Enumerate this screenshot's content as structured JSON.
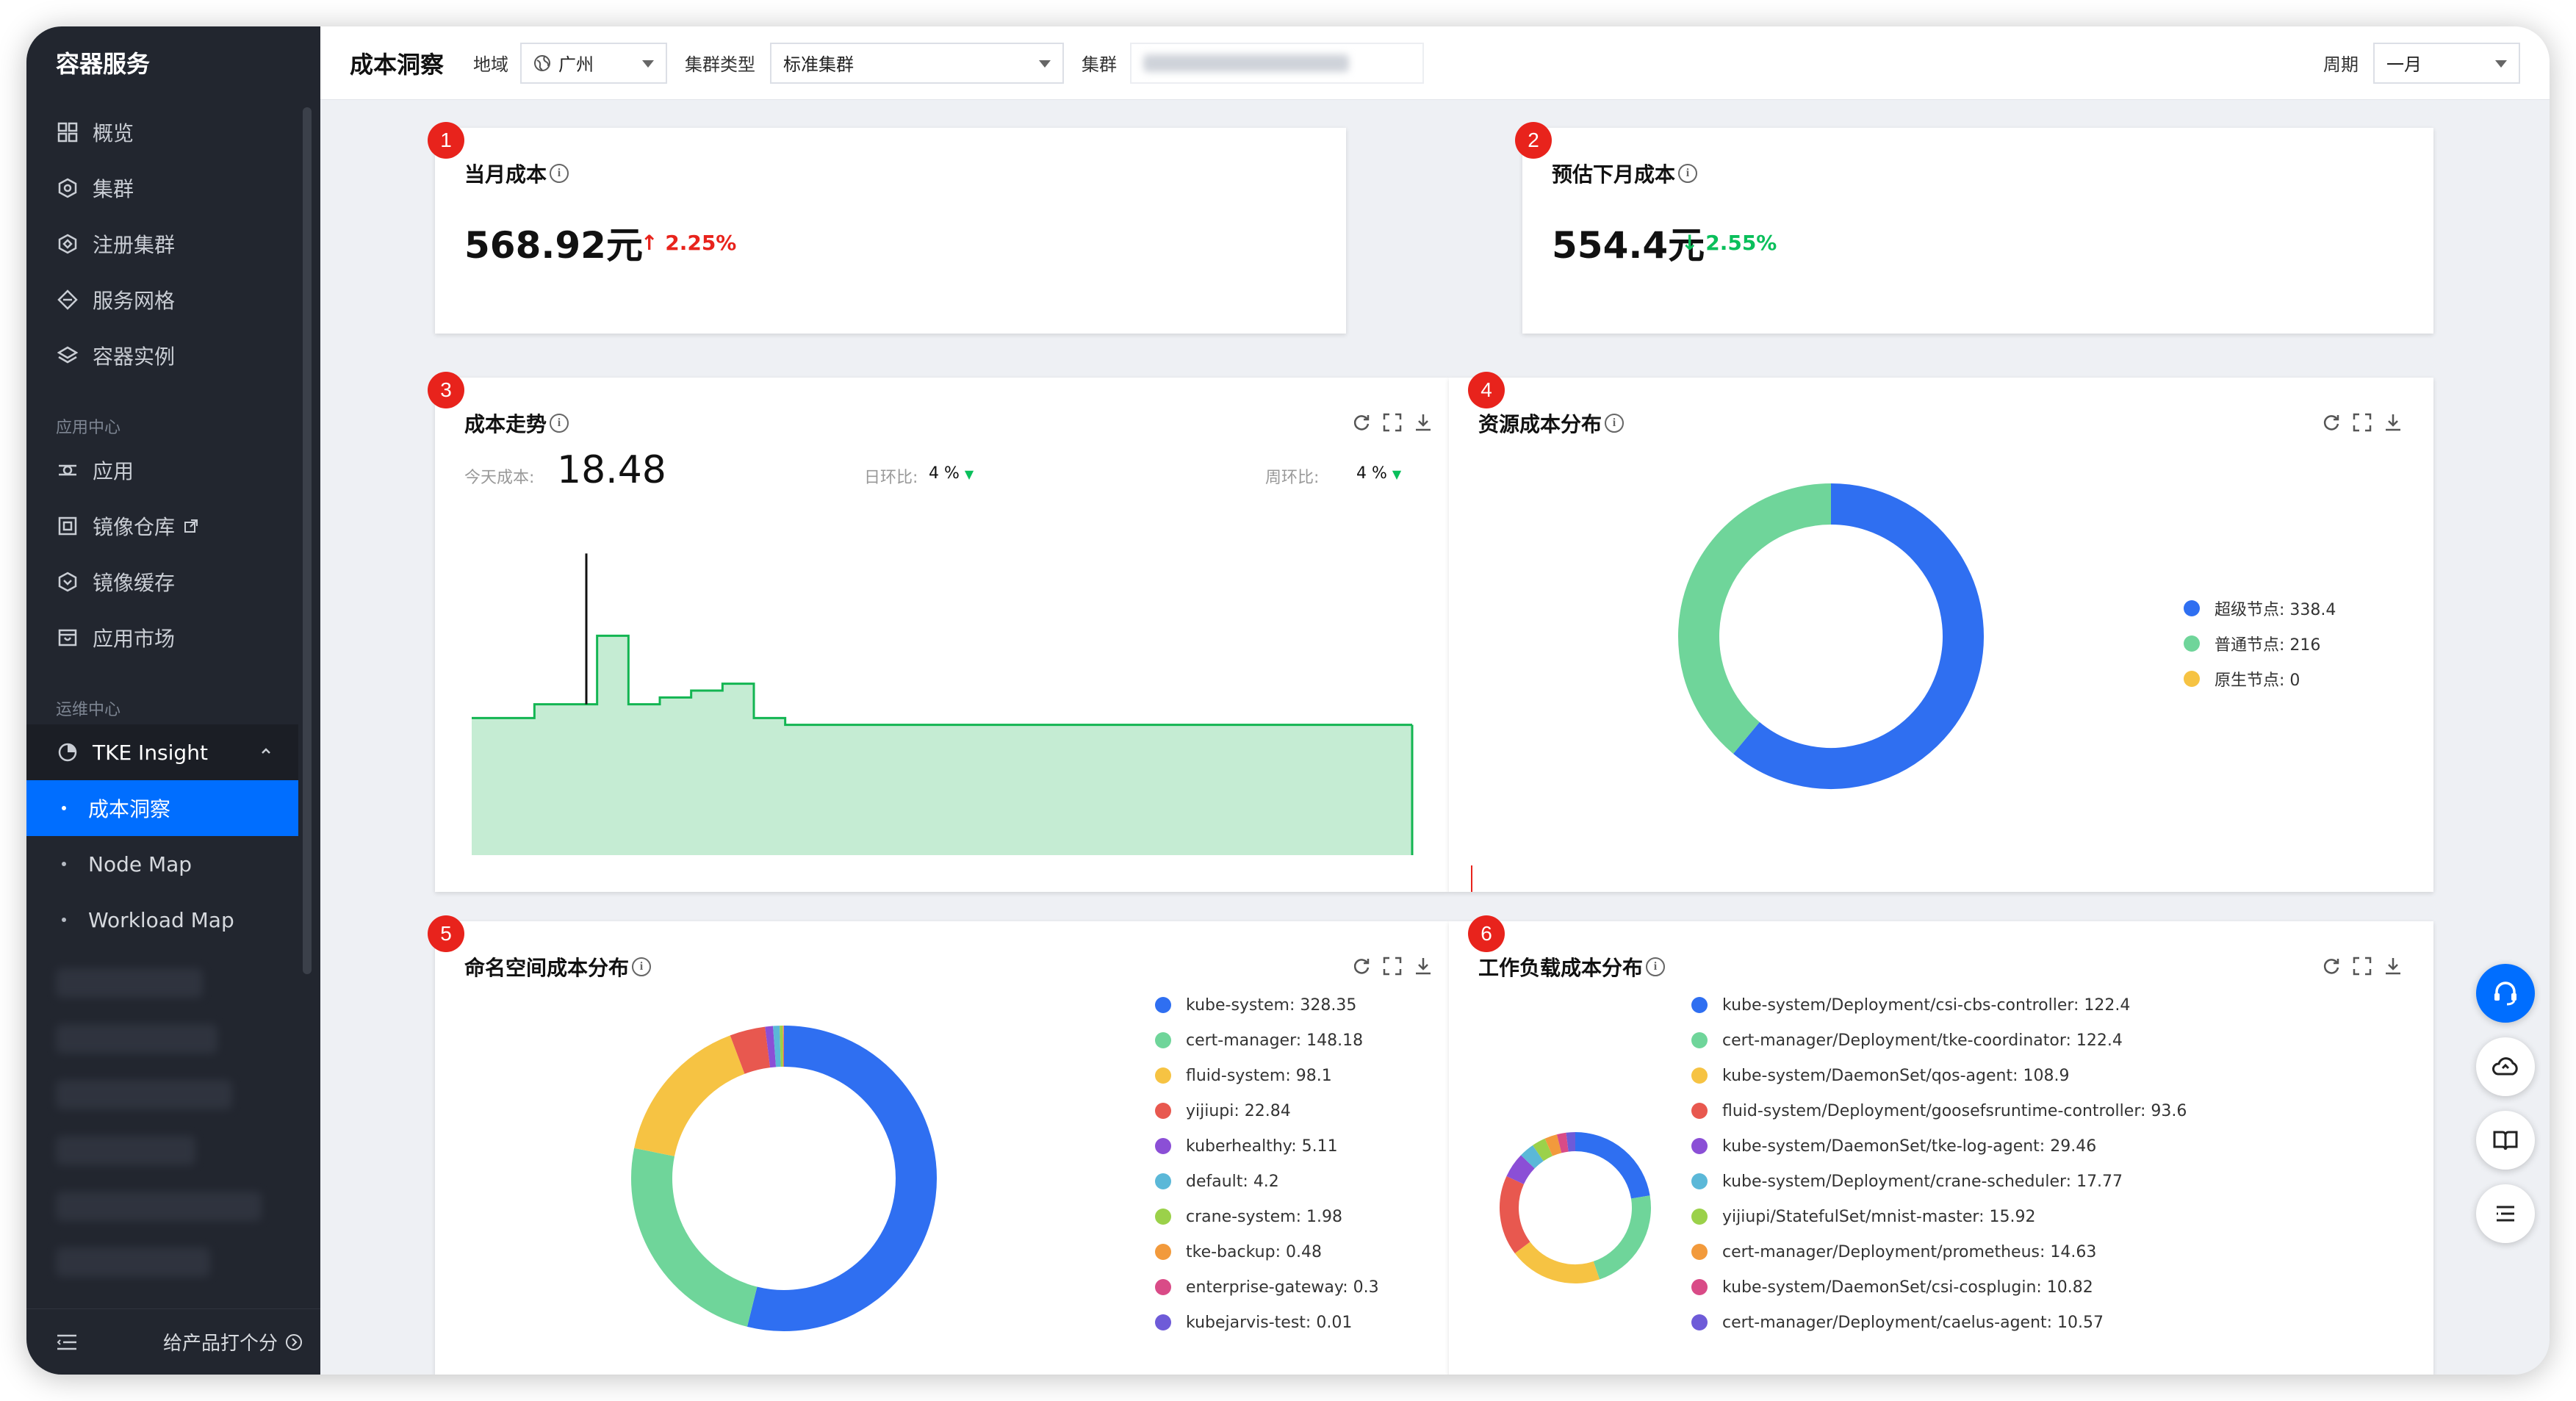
{
  "sidebar": {
    "title": "容器服务",
    "items": [
      {
        "label": "概览",
        "icon": "grid-icon"
      },
      {
        "label": "集群",
        "icon": "cluster-icon"
      },
      {
        "label": "注册集群",
        "icon": "register-cluster-icon"
      },
      {
        "label": "服务网格",
        "icon": "mesh-icon"
      },
      {
        "label": "容器实例",
        "icon": "layers-icon"
      }
    ],
    "section_app": "应用中心",
    "app_items": [
      {
        "label": "应用",
        "icon": "app-icon"
      },
      {
        "label": "镜像仓库",
        "icon": "image-repo-icon"
      },
      {
        "label": "镜像缓存",
        "icon": "image-cache-icon"
      },
      {
        "label": "应用市场",
        "icon": "market-icon"
      }
    ],
    "section_ops": "运维中心",
    "tke_insight": "TKE Insight",
    "sub_items": [
      {
        "label": "成本洞察",
        "active": true
      },
      {
        "label": "Node Map",
        "active": false
      },
      {
        "label": "Workload Map",
        "active": false
      }
    ],
    "footer_label": "给产品打个分"
  },
  "header": {
    "page_title": "成本洞察",
    "region_label": "地域",
    "region_value": "广州",
    "cluster_type_label": "集群类型",
    "cluster_type_value": "标准集群",
    "cluster_label": "集群",
    "period_label": "周期",
    "period_value": "一月"
  },
  "cards": {
    "current_cost": {
      "badge": "1",
      "title": "当月成本",
      "value": "568.92元",
      "delta": "2.25%",
      "delta_dir": "up"
    },
    "forecast_cost": {
      "badge": "2",
      "title": "预估下月成本",
      "value": "554.4元",
      "delta": "2.55%",
      "delta_dir": "down"
    },
    "trend": {
      "badge": "3",
      "title": "成本走势",
      "today_label": "今天成本:",
      "today_value": "18.48",
      "dod_label": "日环比:",
      "dod_value": "4 %",
      "wow_label": "周环比:",
      "wow_value": "4 %"
    },
    "resource": {
      "badge": "4",
      "title": "资源成本分布"
    },
    "namespace": {
      "badge": "5",
      "title": "命名空间成本分布"
    },
    "workload": {
      "badge": "6",
      "title": "工作负载成本分布"
    }
  },
  "colors": {
    "accent": "#006eff",
    "up": "#e8231c",
    "down": "#0abf5b",
    "trend_line": "#13b552",
    "trend_fill": "#c5ecd3"
  },
  "chart_data": [
    {
      "type": "area",
      "title": "成本走势",
      "x": [
        1,
        2,
        3,
        4,
        5,
        6,
        7,
        8,
        9,
        10,
        11,
        12,
        13,
        14,
        15,
        16,
        17,
        18,
        19,
        20,
        21,
        22,
        23,
        24,
        25,
        26,
        27,
        28,
        29,
        30,
        31
      ],
      "values": [
        20,
        20,
        22,
        22,
        32,
        22,
        23,
        24,
        25,
        20,
        19,
        19,
        19,
        19,
        19,
        19,
        19,
        19,
        19,
        19,
        19,
        19,
        19,
        19,
        19,
        19,
        19,
        19,
        19,
        19,
        19
      ],
      "ylim": [
        0,
        45
      ]
    },
    {
      "type": "pie",
      "title": "资源成本分布",
      "labels": [
        "超级节点: 338.4",
        "普通节点: 216",
        "原生节点: 0"
      ],
      "values": [
        338.4,
        216,
        0
      ],
      "colors": [
        "#2f6ff1",
        "#6fd59a",
        "#f6c343"
      ]
    },
    {
      "type": "pie",
      "title": "命名空间成本分布",
      "labels": [
        "kube-system: 328.35",
        "cert-manager: 148.18",
        "fluid-system: 98.1",
        "yijiupi: 22.84",
        "kuberhealthy: 5.11",
        "default: 4.2",
        "crane-system: 1.98",
        "tke-backup: 0.48",
        "enterprise-gateway: 0.3",
        "kubejarvis-test: 0.01"
      ],
      "values": [
        328.35,
        148.18,
        98.1,
        22.84,
        5.11,
        4.2,
        1.98,
        0.48,
        0.3,
        0.01
      ],
      "colors": [
        "#2f6ff1",
        "#6fd59a",
        "#f6c343",
        "#e8584f",
        "#8b4fd6",
        "#5bb8d8",
        "#9bd14a",
        "#f29a3c",
        "#d94b87",
        "#6e5bd8"
      ]
    },
    {
      "type": "pie",
      "title": "工作负载成本分布",
      "labels": [
        "kube-system/Deployment/csi-cbs-controller: 122.4",
        "cert-manager/Deployment/tke-coordinator: 122.4",
        "kube-system/DaemonSet/qos-agent: 108.9",
        "fluid-system/Deployment/goosefsruntime-controller: 93.6",
        "kube-system/DaemonSet/tke-log-agent: 29.46",
        "kube-system/Deployment/crane-scheduler: 17.77",
        "yijiupi/StatefulSet/mnist-master: 15.92",
        "cert-manager/Deployment/prometheus: 14.63",
        "kube-system/DaemonSet/csi-cosplugin: 10.82",
        "cert-manager/Deployment/caelus-agent: 10.57"
      ],
      "values": [
        122.4,
        122.4,
        108.9,
        93.6,
        29.46,
        17.77,
        15.92,
        14.63,
        10.82,
        10.57
      ],
      "colors": [
        "#2f6ff1",
        "#6fd59a",
        "#f6c343",
        "#e8584f",
        "#8b4fd6",
        "#5bb8d8",
        "#9bd14a",
        "#f29a3c",
        "#d94b87",
        "#6e5bd8"
      ]
    }
  ]
}
